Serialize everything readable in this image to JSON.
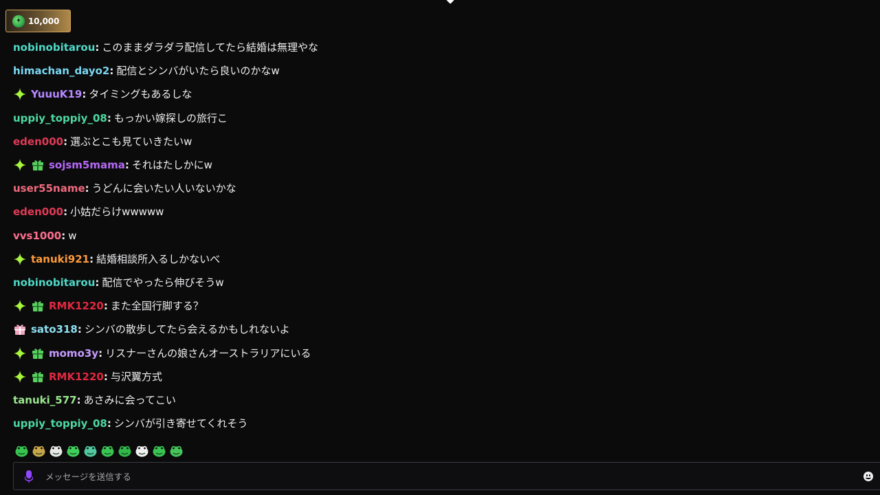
{
  "points": {
    "value": "10,000",
    "icon": "channel-points-icon"
  },
  "colors": {
    "background": "#0b0b0c",
    "text": "#efeff1",
    "sparkle_badge": "#a7f63b",
    "gift_badge": "#5bd05f",
    "pink_gift_badge": "#f2a6c0",
    "input_border": "#3b3b40",
    "mic": "#9147ff"
  },
  "messages": [
    {
      "username": "nobinobitarou",
      "color": "#4ed8c6",
      "badges": [],
      "text": "このままダラダラ配信してたら結婚は無理やな"
    },
    {
      "username": "himachan_dayo2",
      "color": "#79d6f0",
      "badges": [],
      "text": "配信とシンバがいたら良いのかなw"
    },
    {
      "username": "YuuuK19",
      "color": "#b788ff",
      "badges": [
        "sparkle"
      ],
      "text": "タイミングもあるしな"
    },
    {
      "username": "uppiy_toppiy_08",
      "color": "#4ed8a0",
      "badges": [],
      "text": "もっかい嫁探しの旅行こ"
    },
    {
      "username": "eden000",
      "color": "#e03a55",
      "badges": [],
      "text": "選ぶとこも見ていきたいw"
    },
    {
      "username": "sojsm5mama",
      "color": "#b56af5",
      "badges": [
        "sparkle",
        "gift"
      ],
      "text": "それはたしかにw"
    },
    {
      "username": "user55name",
      "color": "#f06a7e",
      "badges": [],
      "text": "うどんに会いたい人いないかな"
    },
    {
      "username": "eden000",
      "color": "#e03a55",
      "badges": [],
      "text": "小姑だらけwwwww"
    },
    {
      "username": "vvs1000",
      "color": "#ff6f8e",
      "badges": [],
      "text": "w"
    },
    {
      "username": "tanuki921",
      "color": "#ff9a3a",
      "badges": [
        "sparkle"
      ],
      "text": "結婚相談所入るしかないべ"
    },
    {
      "username": "nobinobitarou",
      "color": "#4ed8c6",
      "badges": [],
      "text": "配信でやったら伸びそうw"
    },
    {
      "username": "RMK1220",
      "color": "#e0283f",
      "badges": [
        "sparkle",
        "gift"
      ],
      "text": "また全国行脚する？"
    },
    {
      "username": "sato318",
      "color": "#8fe0f0",
      "badges": [
        "pink-gift"
      ],
      "text": "シンバの散歩してたら会えるかもしれないよ"
    },
    {
      "username": "momo3y",
      "color": "#c79cff",
      "badges": [
        "sparkle",
        "gift"
      ],
      "text": "リスナーさんの娘さんオーストラリアにいる"
    },
    {
      "username": "RMK1220",
      "color": "#e0283f",
      "badges": [
        "sparkle",
        "gift"
      ],
      "text": "与沢翼方式"
    },
    {
      "username": "tanuki_577",
      "color": "#9be88f",
      "badges": [],
      "text": "あさみに会ってこい"
    },
    {
      "username": "uppiy_toppiy_08",
      "color": "#4ed8a0",
      "badges": [],
      "text": "シンバが引き寄せてくれそう"
    }
  ],
  "emotes": [
    {
      "name": "frog-emote-1",
      "color": "#36c44e"
    },
    {
      "name": "box-emote",
      "color": "#c8a64a"
    },
    {
      "name": "frog-emote-2",
      "color": "#e8e8e8"
    },
    {
      "name": "frog-emote-3",
      "color": "#3fcf5a"
    },
    {
      "name": "frog-emote-4",
      "color": "#52c8a0"
    },
    {
      "name": "frog-emote-5",
      "color": "#3ac452"
    },
    {
      "name": "frog-emote-6",
      "color": "#30b84a"
    },
    {
      "name": "frog-emote-7",
      "color": "#f0f0f0"
    },
    {
      "name": "frog-emote-8",
      "color": "#3ac452"
    },
    {
      "name": "frog-emote-9",
      "color": "#46c45a"
    }
  ],
  "input": {
    "placeholder": "メッセージを送信する"
  }
}
